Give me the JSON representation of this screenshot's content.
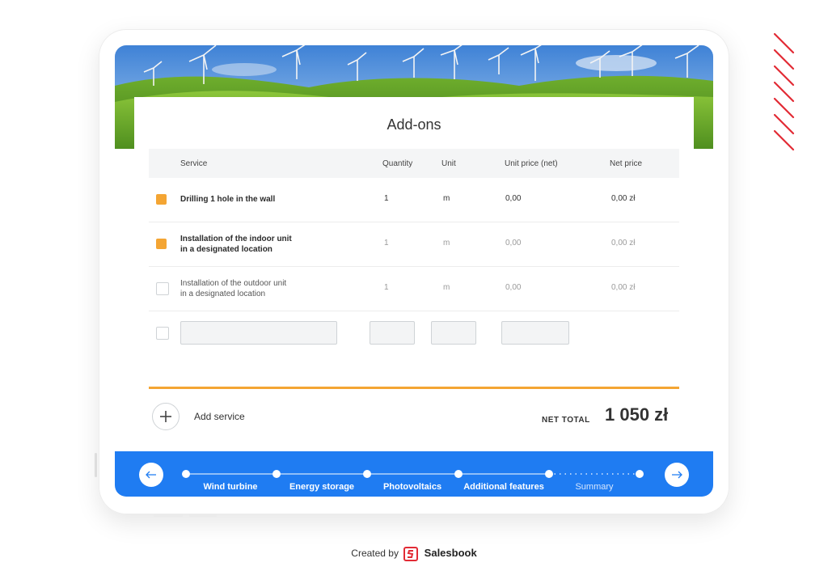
{
  "card": {
    "title": "Add-ons"
  },
  "table": {
    "headers": {
      "service": "Service",
      "quantity": "Quantity",
      "unit": "Unit",
      "unit_price": "Unit price (net)",
      "net_price": "Net price"
    },
    "rows": [
      {
        "checked": true,
        "service_line1": "Drilling 1 hole in the wall",
        "service_line2": "",
        "quantity": "1",
        "unit": "m",
        "unit_price": "0,00",
        "net_price": "0,00 zł"
      },
      {
        "checked": true,
        "service_line1": "Installation of the indoor unit",
        "service_line2": "in a designated location",
        "quantity": "1",
        "unit": "m",
        "unit_price": "0,00",
        "net_price": "0,00 zł"
      },
      {
        "checked": false,
        "service_line1": "Installation of the outdoor unit",
        "service_line2": "in a designated location",
        "quantity": "1",
        "unit": "m",
        "unit_price": "0,00",
        "net_price": "0,00 zł"
      }
    ],
    "new_row": {
      "service": "",
      "quantity": "",
      "unit": "",
      "unit_price": ""
    }
  },
  "actions": {
    "add_service": "Add service"
  },
  "totals": {
    "label": "NET TOTAL",
    "value": "1 050 zł"
  },
  "nav": {
    "steps": [
      "Wind turbine",
      "Energy storage",
      "Photovoltaics",
      "Additional features",
      "Summary"
    ],
    "current_step": "Summary"
  },
  "footer": {
    "created_by": "Created by",
    "brand": "Salesbook"
  },
  "colors": {
    "accent_orange": "#f4a533",
    "nav_blue": "#1f7cf2",
    "brand_red": "#e22b35"
  }
}
